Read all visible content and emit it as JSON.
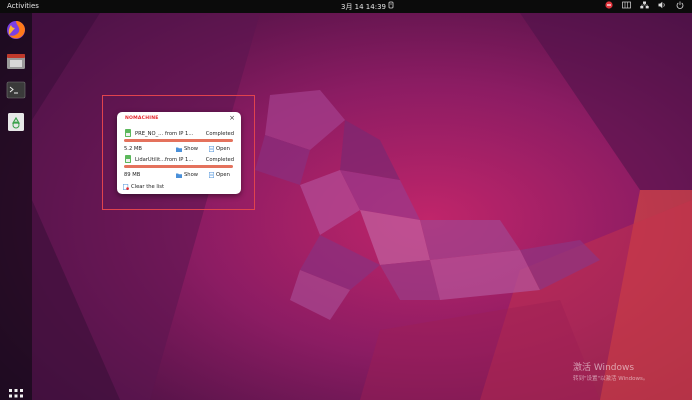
{
  "topbar": {
    "activities_label": "Activities",
    "clock": "3月 14  14:39",
    "tray_icons": [
      "no-entry-icon",
      "network-bars-icon",
      "network-icon",
      "speaker-icon",
      "power-icon"
    ]
  },
  "dock": {
    "items": [
      "firefox-icon",
      "files-icon",
      "terminal-icon",
      "trash-icon"
    ],
    "apps_grid_icon": "grid-icon"
  },
  "notification": {
    "brand": "NOMACHINE",
    "close_label": "×",
    "transfers": [
      {
        "file": "PRE_NO_...",
        "from": "from IP 1...",
        "status": "Completed",
        "progress": 1.0,
        "size": "5.2 MB",
        "show_label": "Show",
        "open_label": "Open"
      },
      {
        "file": "LidarUtilit...",
        "from": "from IP 1...",
        "status": "Completed",
        "progress": 1.0,
        "size": "89 MB",
        "show_label": "Show",
        "open_label": "Open"
      }
    ],
    "clear_label": "Clear the list"
  },
  "watermark": {
    "line1": "激活 Windows",
    "line2": "转到\"设置\"以激活 Windows。"
  },
  "colors": {
    "accent": "#e4262d",
    "progress": "#e4725d",
    "highlight": "#e0434e",
    "topbar": "#0b0b0b"
  }
}
